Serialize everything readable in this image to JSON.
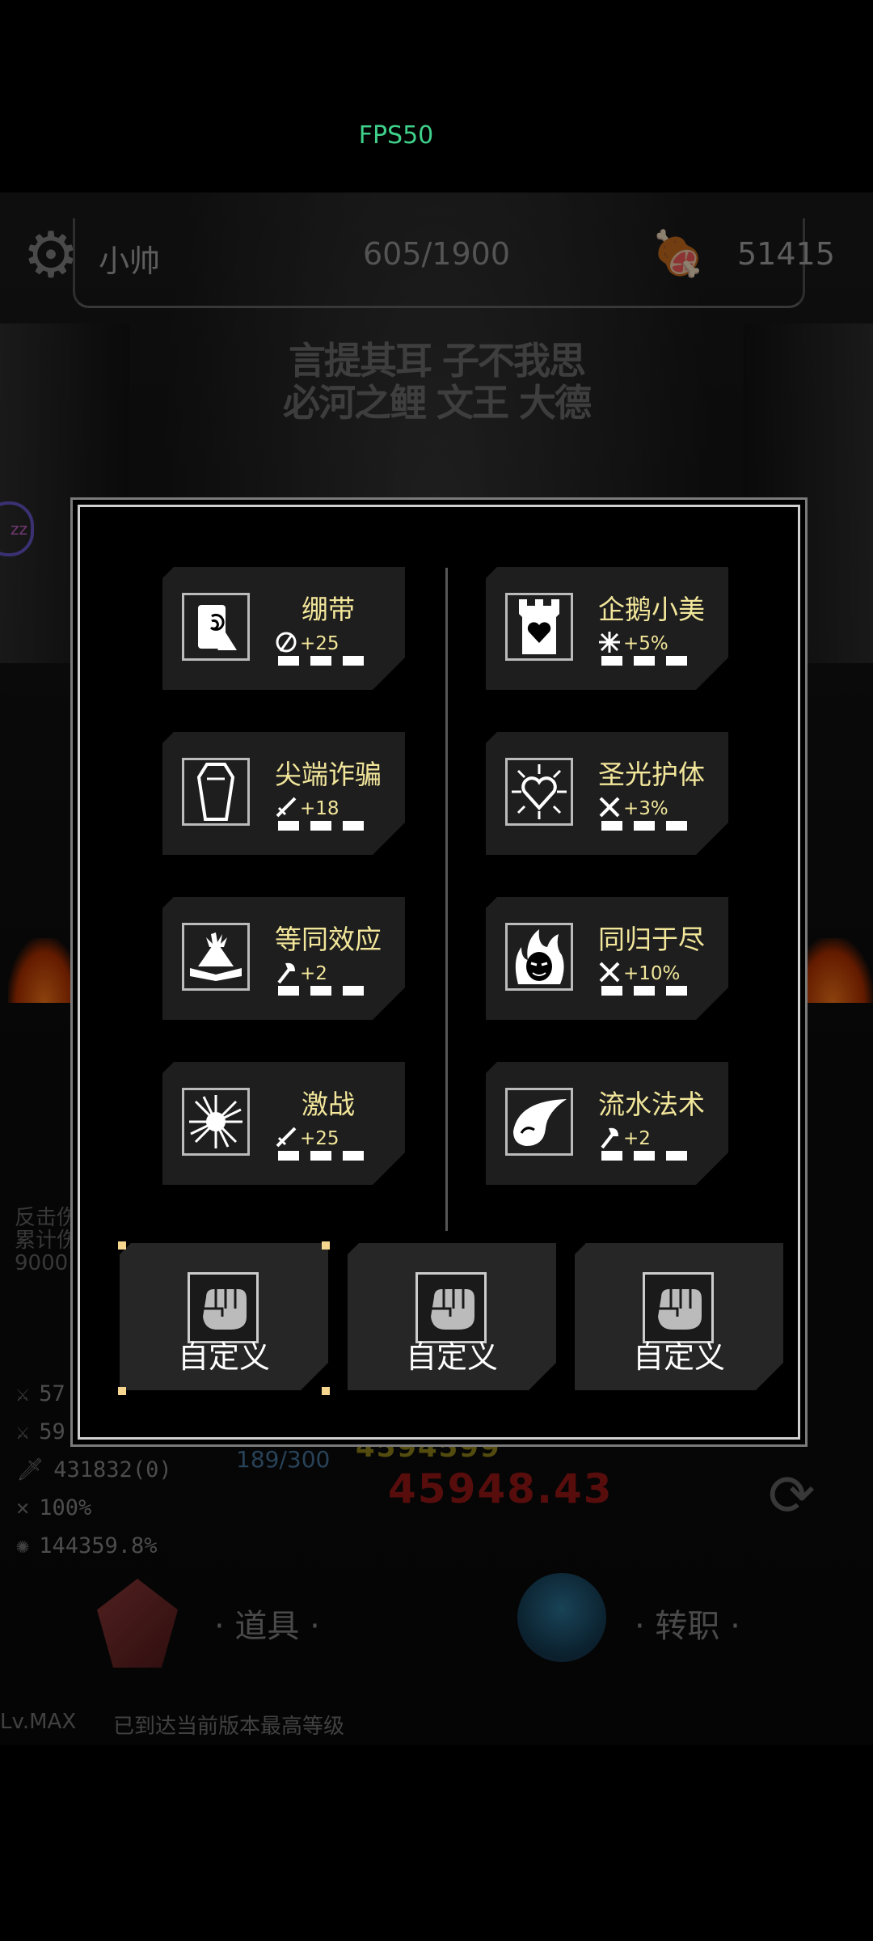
{
  "status_bar": {
    "fps": "FPS50"
  },
  "hud": {
    "username": "小帅",
    "hp": "605/1900",
    "gold": "51415"
  },
  "banner_text": [
    "言提其耳",
    "子不我思",
    "必河之鲤",
    "文王",
    "大德"
  ],
  "background_stats": {
    "rows": [
      "431832(0)",
      "100%",
      "144359.8%"
    ],
    "partial_rows": [
      "57",
      "59"
    ],
    "xp": "189/300",
    "damage_top": "4594599",
    "damage_big": "45948.43",
    "side_text": [
      "反击伤",
      "累计伤",
      "9000"
    ],
    "items_label": "· 道具 ·",
    "job_label": "· 转职 ·",
    "level": "Lv.MAX",
    "level_desc": "已到达当前版本最高等级"
  },
  "skills": {
    "left": [
      {
        "name": "绷带",
        "stat": "+25",
        "icon": "bandage-icon",
        "stat_icon": "heal-icon"
      },
      {
        "name": "尖端诈骗",
        "stat": "+18",
        "icon": "coffin-icon",
        "stat_icon": "sword-icon"
      },
      {
        "name": "等同效应",
        "stat": "+2",
        "icon": "book-icon",
        "stat_icon": "axe-icon"
      },
      {
        "name": "激战",
        "stat": "+25",
        "icon": "burst-icon",
        "stat_icon": "sword-icon"
      }
    ],
    "right": [
      {
        "name": "企鹅小美",
        "stat": "+5%",
        "icon": "tower-heart-icon",
        "stat_icon": "crit-icon"
      },
      {
        "name": "圣光护体",
        "stat": "+3%",
        "icon": "radiant-heart-icon",
        "stat_icon": "cross-swords-icon"
      },
      {
        "name": "同归于尽",
        "stat": "+10%",
        "icon": "flame-face-icon",
        "stat_icon": "cross-swords-icon"
      },
      {
        "name": "流水法术",
        "stat": "+2",
        "icon": "wave-icon",
        "stat_icon": "axe-icon"
      }
    ]
  },
  "custom_slots": [
    {
      "label": "自定义",
      "selected": true
    },
    {
      "label": "自定义",
      "selected": false
    },
    {
      "label": "自定义",
      "selected": false
    }
  ],
  "colors": {
    "accent_text": "#f2e69a",
    "card_bg": "#1e1e1e",
    "fps": "#3fd08a"
  }
}
